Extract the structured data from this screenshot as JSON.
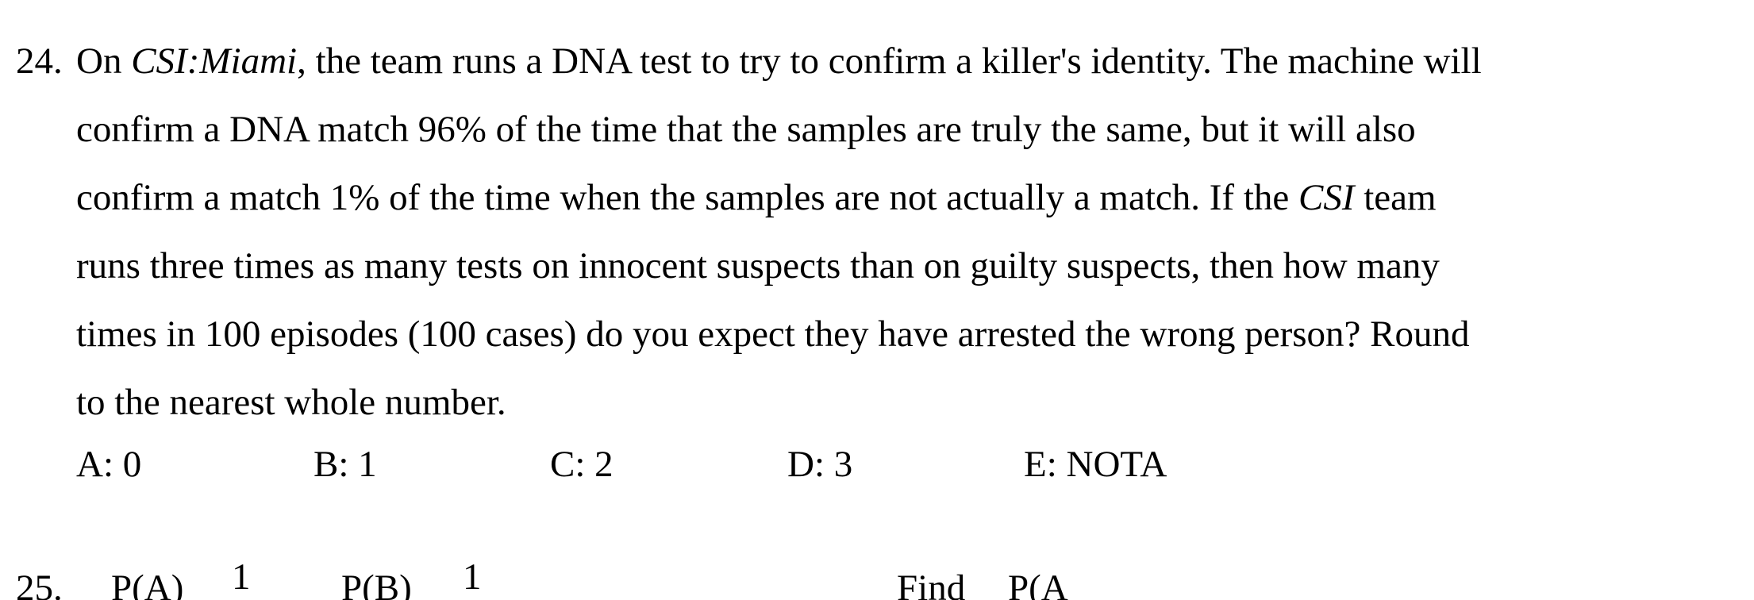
{
  "problem24": {
    "number": "24.",
    "lines": [
      {
        "before": "On ",
        "italic": "CSI:Miami",
        "after": ", the team runs a DNA test to try to confirm a killer's identity.  The machine will"
      },
      {
        "text": "confirm a DNA match 96% of the time that the samples are truly the same, but it will also"
      },
      {
        "before": "confirm a match 1% of the time when the samples are not actually a match.  If the ",
        "italic": "CSI",
        "after": " team"
      },
      {
        "text": "runs three times as many tests on innocent suspects than on guilty suspects, then how many"
      },
      {
        "text": "times in 100 episodes (100 cases) do you expect they have arrested the wrong person?  Round"
      },
      {
        "text": "to the nearest whole number."
      }
    ],
    "choices": [
      {
        "label": "A: 0"
      },
      {
        "label": "B:  1"
      },
      {
        "label": "C: 2"
      },
      {
        "label": "D:  3"
      },
      {
        "label": "E: NOTA"
      }
    ]
  },
  "problem25_partial": {
    "number_fragment": "25.",
    "fragment_a": "P(A)",
    "numerator_a": "1",
    "fragment_b": "P(B)",
    "numerator_b": "1",
    "fragment_find": "Find",
    "fragment_pab": "P(A"
  }
}
